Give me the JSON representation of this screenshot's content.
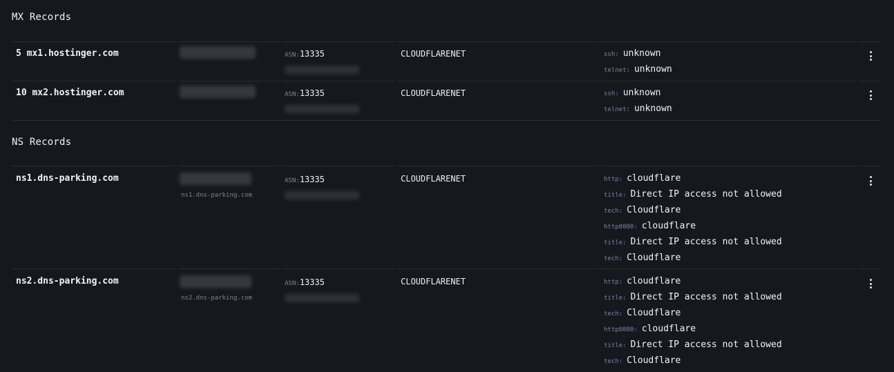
{
  "sections": {
    "mx": {
      "title": "MX Records",
      "rows": [
        {
          "host": "5 mx1.hostinger.com",
          "asn_label": "ASN:",
          "asn": "13335",
          "org": "CLOUDFLARENET",
          "services": [
            {
              "key": "ssh:",
              "value": "unknown"
            },
            {
              "key": "telnet:",
              "value": "unknown"
            }
          ],
          "menu_icon": "kebab-icon"
        },
        {
          "host": "10 mx2.hostinger.com",
          "asn_label": "ASN:",
          "asn": "13335",
          "org": "CLOUDFLARENET",
          "services": [
            {
              "key": "ssh:",
              "value": "unknown"
            },
            {
              "key": "telnet:",
              "value": "unknown"
            }
          ],
          "menu_icon": "kebab-icon"
        }
      ]
    },
    "ns": {
      "title": "NS Records",
      "rows": [
        {
          "host": "ns1.dns-parking.com",
          "ptr": "ns1.dns-parking.com",
          "asn_label": "ASN:",
          "asn": "13335",
          "org": "CLOUDFLARENET",
          "services": [
            {
              "key": "http:",
              "value": "cloudflare"
            },
            {
              "key": "title:",
              "value": "Direct IP access not allowed"
            },
            {
              "key": "tech:",
              "value": "Cloudflare"
            },
            {
              "key": "http8080:",
              "value": "cloudflare"
            },
            {
              "key": "title:",
              "value": "Direct IP access not allowed"
            },
            {
              "key": "tech:",
              "value": "Cloudflare"
            }
          ],
          "menu_icon": "kebab-icon"
        },
        {
          "host": "ns2.dns-parking.com",
          "ptr": "ns2.dns-parking.com",
          "asn_label": "ASN:",
          "asn": "13335",
          "org": "CLOUDFLARENET",
          "services": [
            {
              "key": "http:",
              "value": "cloudflare"
            },
            {
              "key": "title:",
              "value": "Direct IP access not allowed"
            },
            {
              "key": "tech:",
              "value": "Cloudflare"
            },
            {
              "key": "http8080:",
              "value": "cloudflare"
            },
            {
              "key": "title:",
              "value": "Direct IP access not allowed"
            },
            {
              "key": "tech:",
              "value": "Cloudflare"
            }
          ],
          "menu_icon": "kebab-icon"
        }
      ]
    }
  }
}
